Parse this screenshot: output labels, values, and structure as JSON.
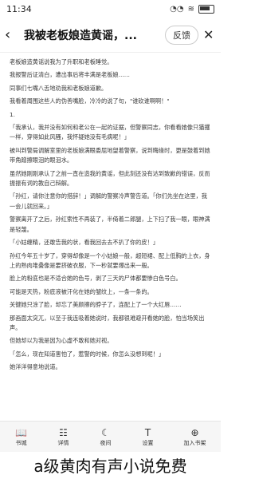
{
  "status": {
    "time": "11:34",
    "right": "⚡ 📶 ▮"
  },
  "header": {
    "title": "我被老板娘造黄谣，...",
    "feedback_label": "反馈"
  },
  "content": {
    "paragraphs": [
      "老板娘造黄谣说我为了升职和老板睡觉。",
      "我报警后证清白，遭出事后将丰满是老板娘……",
      "同事们七嘴八舌地劝我和老板娘道歉。",
      "我看着周围这些人的伪善嘴脸，冷冷的说了句，\"谁砍谁啊啊！\"",
      "1.",
      "「我承认，我并没有如何和老公在一起的证据，但警察同志，你看看她像只猫攫一样，穿得如此风骚，我怀疑她没有毛病呢！」",
      "被叫到警局调解室里的老板娘满眼委屈地望着警察，说到晦缘时，更是鼓着到她带角蹭擦眼泪的眼泪水。",
      "虽然她刚刚承认了之前一直在造我的黄谣，但此刻还没有达到致歉的错误，反而振振有词的教自己辩解。",
      "「孙红，请你注意你的措辞！」调解的警察冷声警告道。「你们先坐在这里，我一会儿就回来。」",
      "警察离开了之后，孙红索性不再装了，半倚着二郎腿，上下扫了我一眼，眼神满是轻蔑。",
      "「小姑缠精，还敢告我的状，看我回去去不扒了你的皮！」",
      "孙红今年五十岁了，穿得却像是一个小姑娘一般，超短裙、配上低胸的上衣，身上的熟肉堆叠像是要挤破衣服，下一秒就要爆出来一般。",
      "脸上的粉底也是不适合她的色号，剥了三天的尸体都要惨白色号白。",
      "可能是天热，粉底液被汗化在她的皱纹上，一条一条的。",
      "关键她只涂了脸，却忘了美颜擦的脖子了，连配上了一个大红唇……",
      "那画面太突兀，以至于我连吸着她说时，我都很难避开看她的脸，怕当场笑出声。",
      "但她却以为我是因为心虚不敢和她对视。",
      "「怎么，现在知道害怕了，惹警的时候，你怎么没想到呢！」",
      "她洋洋得意地说道。"
    ]
  },
  "bottombar": {
    "tabs": [
      {
        "label": "书城",
        "icon": "book-icon"
      },
      {
        "label": "详情",
        "icon": "detail-icon"
      },
      {
        "label": "夜间",
        "icon": "moon-icon"
      },
      {
        "label": "设置",
        "icon": "font-settings-icon"
      },
      {
        "label": "加入书架",
        "icon": "add-bookshelf-icon"
      }
    ]
  },
  "caption": "a级黄肉有声小说免费"
}
